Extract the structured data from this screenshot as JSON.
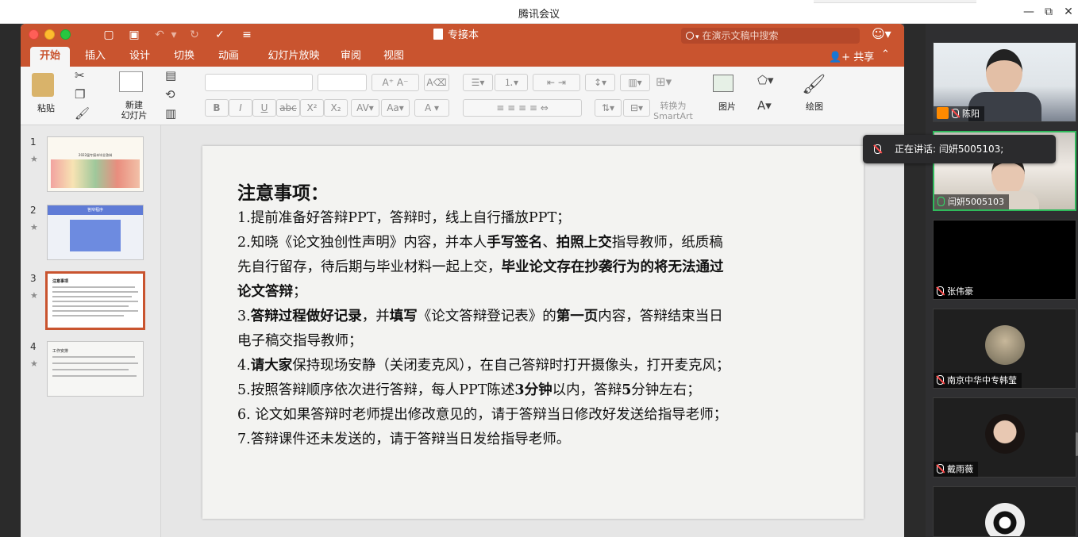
{
  "meeting": {
    "window_title": "腾讯会议",
    "controls": {
      "minimize": "—",
      "restore": "⧉",
      "close": "✕"
    }
  },
  "ppt": {
    "document_title": "专接本",
    "search_placeholder": "在演示文稿中搜索",
    "tabs": [
      "开始",
      "插入",
      "设计",
      "切换",
      "动画",
      "幻灯片放映",
      "审阅",
      "视图"
    ],
    "active_tab": "开始",
    "share_label": "共享",
    "ribbon": {
      "paste": "粘贴",
      "new_slide_line1": "新建",
      "new_slide_line2": "幻灯片",
      "convert_line1": "转换为",
      "convert_line2": "SmartArt",
      "picture": "图片",
      "drawing": "绘图",
      "font_bold": "B",
      "font_italic": "I",
      "font_underline": "U",
      "font_strike": "abc",
      "font_sup": "X²",
      "font_sub": "X₂"
    },
    "thumbnails": [
      {
        "num": "1",
        "star": "★",
        "title": "2022届专接本毕业答辩"
      },
      {
        "num": "2",
        "star": "★",
        "title": "答辩程序"
      },
      {
        "num": "3",
        "star": "★",
        "title": "注意事项"
      },
      {
        "num": "4",
        "star": "★",
        "title": "工作安排"
      }
    ],
    "slide": {
      "heading": "注意事项：",
      "lines": [
        {
          "a": "1.提前准备好答辩PPT，答辩时，线上自行播放PPT；"
        },
        {
          "a": "2.知晓《论文独创性声明》内容，并本人",
          "b": "手写签名",
          "c": "、",
          "d": "拍照上交",
          "e": "指导教师，纸质稿"
        },
        {
          "a": "先自行留存，待后期与毕业材料一起上交，",
          "b": "毕业论文存在抄袭行为的将无法通过"
        },
        {
          "b": "论文答辩",
          "a": "；"
        },
        {
          "a": "3.",
          "b": "答辩过程做好记录",
          "c": "，并",
          "d": "填写",
          "e": "《论文答辩登记表》的",
          "f": "第一页",
          "g": "内容，答辩结束当日"
        },
        {
          "a": "电子稿交指导教师；"
        },
        {
          "a": "4.",
          "b": "请大家",
          "c": "保持现场安静（关闭麦克风），在自己答辩时打开摄像头，打开麦克风；"
        },
        {
          "a": "5.按照答辩顺序依次进行答辩，每人PPT陈述",
          "b": "3",
          "c": "分钟",
          "d": "以内，答辩",
          "e": "5",
          "f": "分钟左右；"
        },
        {
          "a": "6. 论文如果答辩时老师提出修改意见的，请于答辩当日修改好发送给指导老师；"
        },
        {
          "a": "7.答辩课件还未发送的，请于答辩当日发给指导老师。"
        }
      ]
    }
  },
  "participants": [
    {
      "name": "陈阳",
      "host": true
    },
    {
      "name": "闫妍5005103",
      "speaking": true
    },
    {
      "name": "张伟豪"
    },
    {
      "name": "南京中华中专韩莹"
    },
    {
      "name": "戴雨薇"
    },
    {
      "name": ""
    }
  ],
  "speaking_tip": "正在讲话: 闫妍5005103;",
  "colors": {
    "ppt_accent": "#c9542f",
    "speaking_border": "#2fba5b"
  }
}
